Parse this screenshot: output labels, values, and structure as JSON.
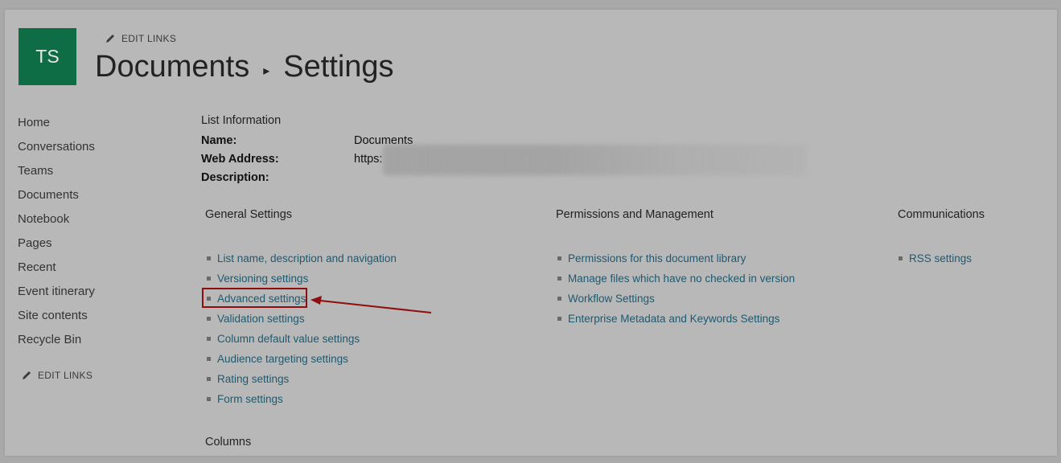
{
  "site": {
    "logo_initials": "TS",
    "logo_color": "#0f6d45"
  },
  "header": {
    "edit_links": "EDIT LINKS",
    "breadcrumb": [
      "Documents",
      "Settings"
    ]
  },
  "leftnav": {
    "items": [
      "Home",
      "Conversations",
      "Teams",
      "Documents",
      "Notebook",
      "Pages",
      "Recent",
      "Event itinerary",
      "Site contents",
      "Recycle Bin"
    ],
    "edit_links": "EDIT LINKS"
  },
  "list_info": {
    "heading": "List Information",
    "name_label": "Name:",
    "name_value": "Documents",
    "web_address_label": "Web Address:",
    "web_address_value": "https:",
    "description_label": "Description:"
  },
  "sections": {
    "general": {
      "heading": "General Settings",
      "links": [
        "List name, description and navigation",
        "Versioning settings",
        "Advanced settings",
        "Validation settings",
        "Column default value settings",
        "Audience targeting settings",
        "Rating settings",
        "Form settings"
      ]
    },
    "permissions": {
      "heading": "Permissions and Management",
      "links": [
        "Permissions for this document library",
        "Manage files which have no checked in version",
        "Workflow Settings",
        "Enterprise Metadata and Keywords Settings"
      ]
    },
    "communications": {
      "heading": "Communications",
      "links": [
        "RSS settings"
      ]
    },
    "columns": {
      "heading": "Columns"
    }
  },
  "annotation": {
    "highlight_color": "#8f0d0d"
  }
}
